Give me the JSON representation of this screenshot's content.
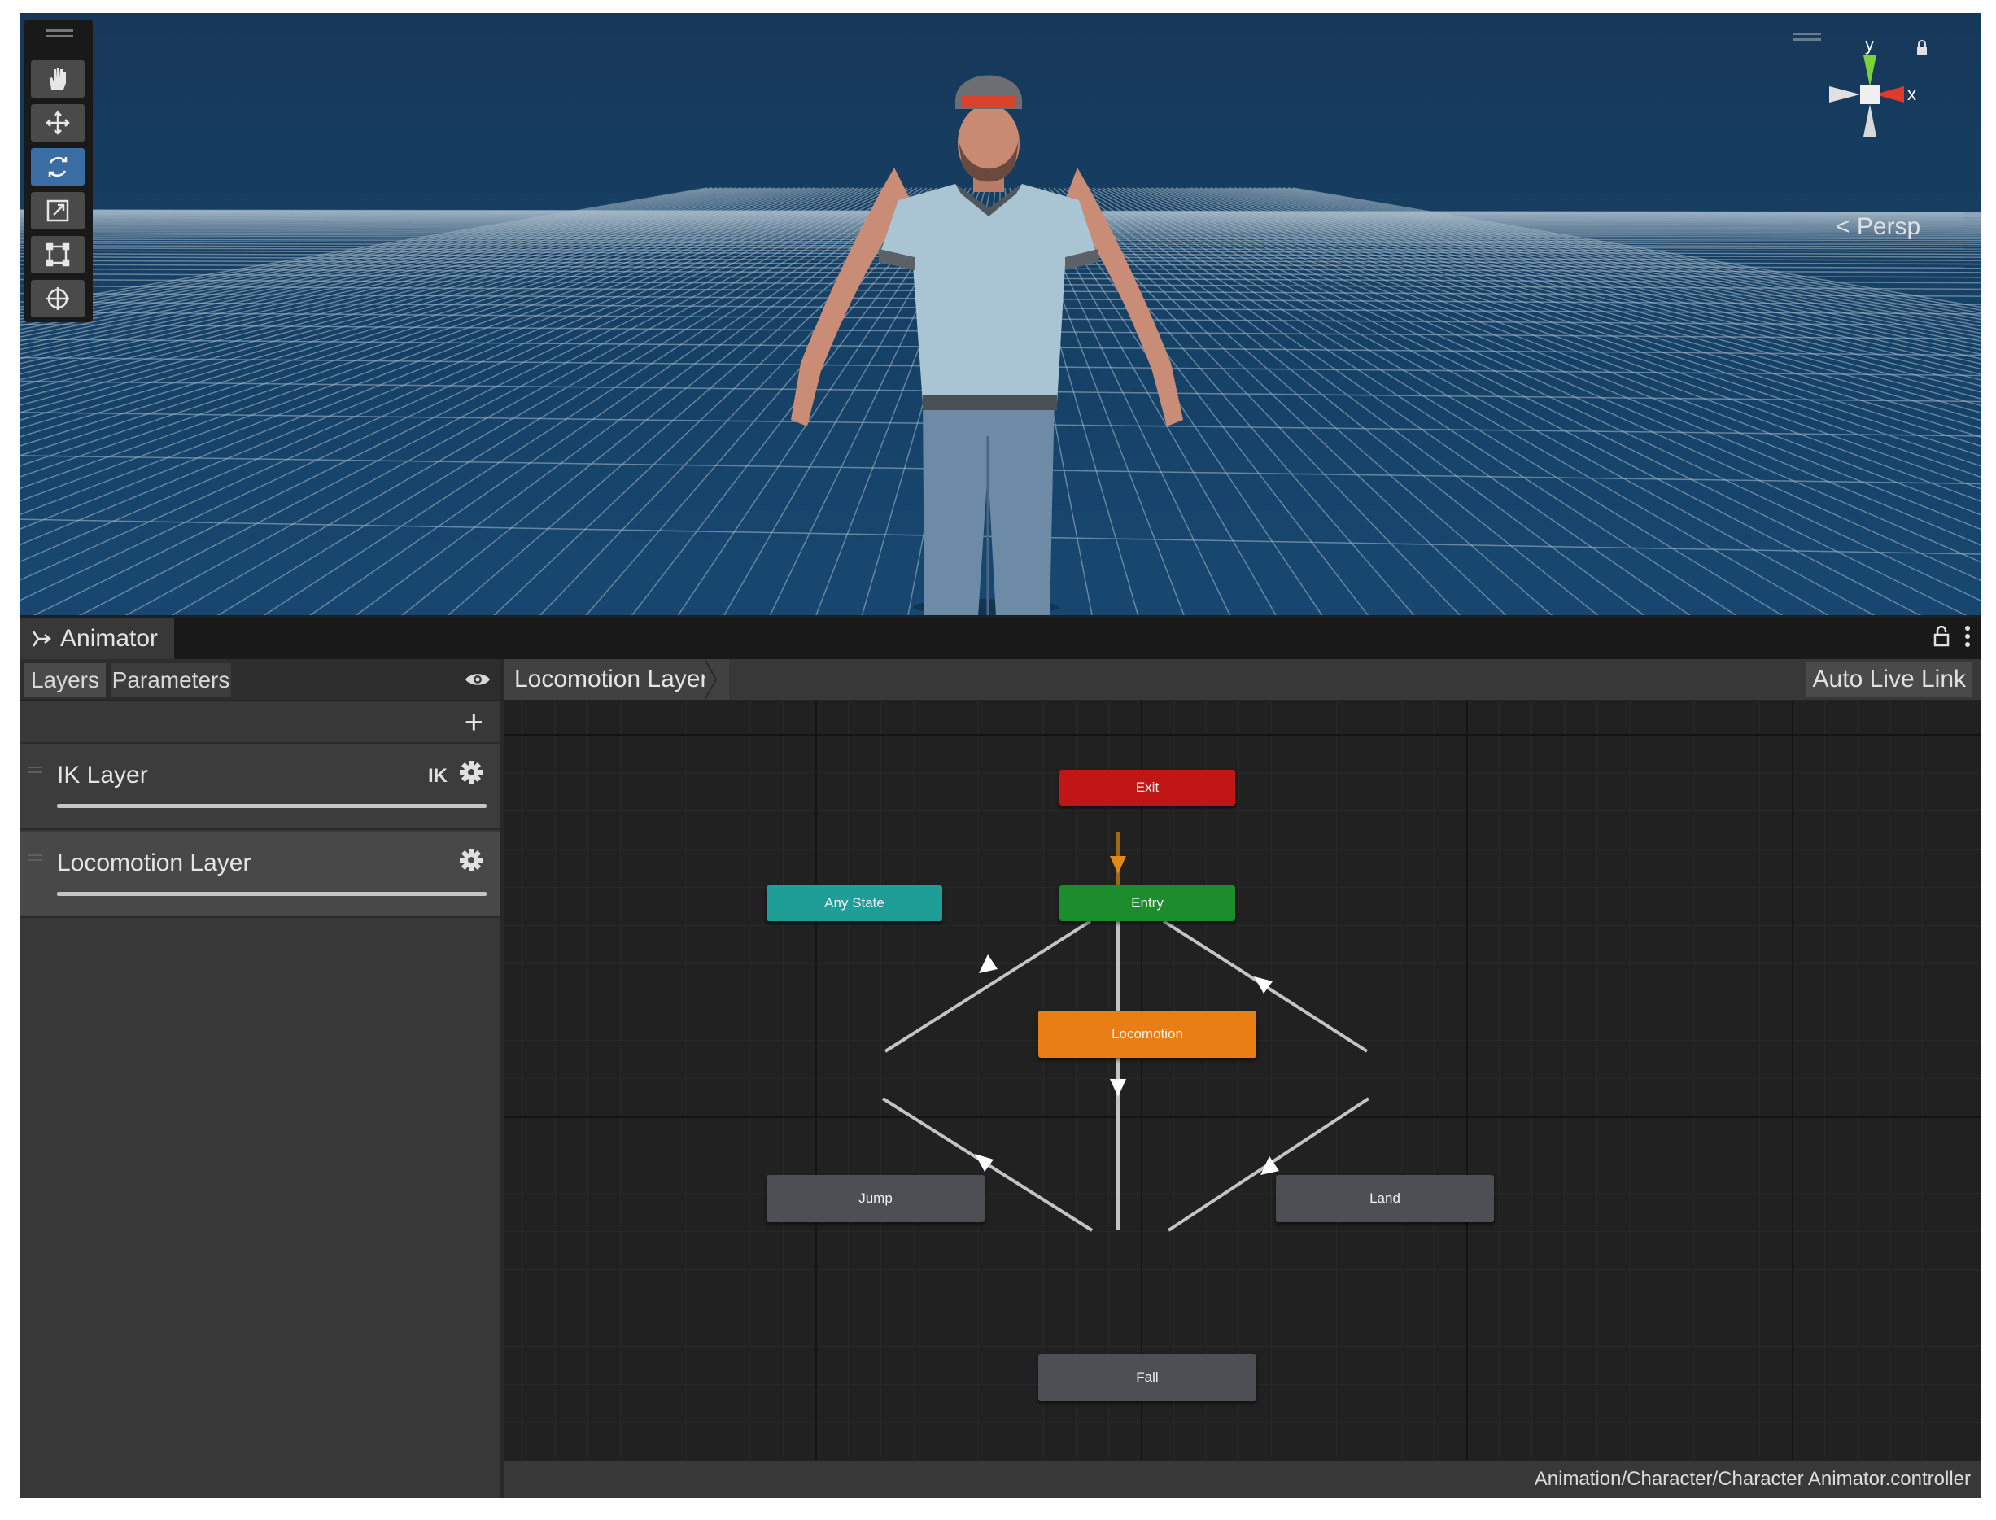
{
  "scene": {
    "toolbar": [
      "hand-tool",
      "move-tool",
      "rotate-tool",
      "scale-tool",
      "rect-tool",
      "transform-tool"
    ],
    "active_tool": "rotate-tool",
    "gizmo": {
      "y_label": "y",
      "x_label": "x"
    },
    "projection_label": "Persp",
    "grid_color": "#b0c0cc",
    "background_color": "#163d60"
  },
  "animator": {
    "window_tab": "Animator",
    "left_tabs": {
      "layers": "Layers",
      "parameters": "Parameters"
    },
    "add_symbol": "+",
    "layers": [
      {
        "name": "IK Layer",
        "badge": "IK"
      },
      {
        "name": "Locomotion Layer",
        "badge": ""
      }
    ],
    "breadcrumb": "Locomotion Layer",
    "auto_live_link": "Auto Live Link",
    "states": {
      "exit": "Exit",
      "any_state": "Any State",
      "entry": "Entry",
      "locomotion": "Locomotion",
      "jump": "Jump",
      "land": "Land",
      "fall": "Fall"
    },
    "state_colors": {
      "exit": "#c01616",
      "any_state": "#1f9e97",
      "entry": "#1c8c2c",
      "default": "#e97e14",
      "normal": "#4c5055"
    },
    "controller_path": "Animation/Character/Character Animator.controller"
  }
}
